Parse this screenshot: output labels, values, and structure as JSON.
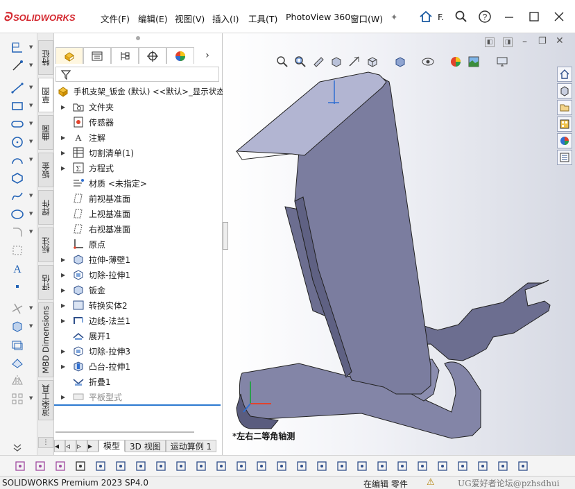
{
  "app": {
    "brand": "SOLIDWORKS",
    "window_label": "F."
  },
  "menu": [
    "文件(F)",
    "编辑(E)",
    "视图(V)",
    "插入(I)",
    "工具(T)",
    "PhotoView 360",
    "窗口(W)"
  ],
  "vertical_tabs": [
    "特征",
    "草图",
    "曲面",
    "钣金",
    "焊件",
    "标注",
    "评估",
    "MBD Dimensions",
    "渲染工具"
  ],
  "tree": {
    "root": "手机支架_钣金 (默认) <<默认>_显示状态",
    "items": [
      {
        "label": "文件夹",
        "expand": true
      },
      {
        "label": "传感器",
        "expand": false
      },
      {
        "label": "注解",
        "expand": true
      },
      {
        "label": "切割清单(1)",
        "expand": true
      },
      {
        "label": "方程式",
        "expand": true
      },
      {
        "label": "材质 <未指定>",
        "expand": false
      },
      {
        "label": "前视基准面",
        "expand": false
      },
      {
        "label": "上视基准面",
        "expand": false
      },
      {
        "label": "右视基准面",
        "expand": false
      },
      {
        "label": "原点",
        "expand": false
      },
      {
        "label": "拉伸-薄壁1",
        "expand": true
      },
      {
        "label": "切除-拉伸1",
        "expand": true
      },
      {
        "label": "钣金",
        "expand": true
      },
      {
        "label": "转换实体2",
        "expand": true
      },
      {
        "label": "边线-法兰1",
        "expand": true
      },
      {
        "label": "展开1",
        "expand": false
      },
      {
        "label": "切除-拉伸3",
        "expand": true
      },
      {
        "label": "凸台-拉伸1",
        "expand": true
      },
      {
        "label": "折叠1",
        "expand": false
      },
      {
        "label": "平板型式",
        "expand": true,
        "dim": true
      }
    ]
  },
  "viewport": {
    "view_label": "*左右二等角轴测"
  },
  "bottom_tabs": [
    "模型",
    "3D 视图",
    "运动算例 1"
  ],
  "status": {
    "product": "SOLIDWORKS Premium 2023 SP4.0",
    "mode": "在编辑 零件",
    "watermark": "UG爱好者论坛@pzhsdhui"
  },
  "colors": {
    "brand": "#d4282f",
    "part_face": "#7e80a4",
    "part_top": "#b6b9d4"
  }
}
